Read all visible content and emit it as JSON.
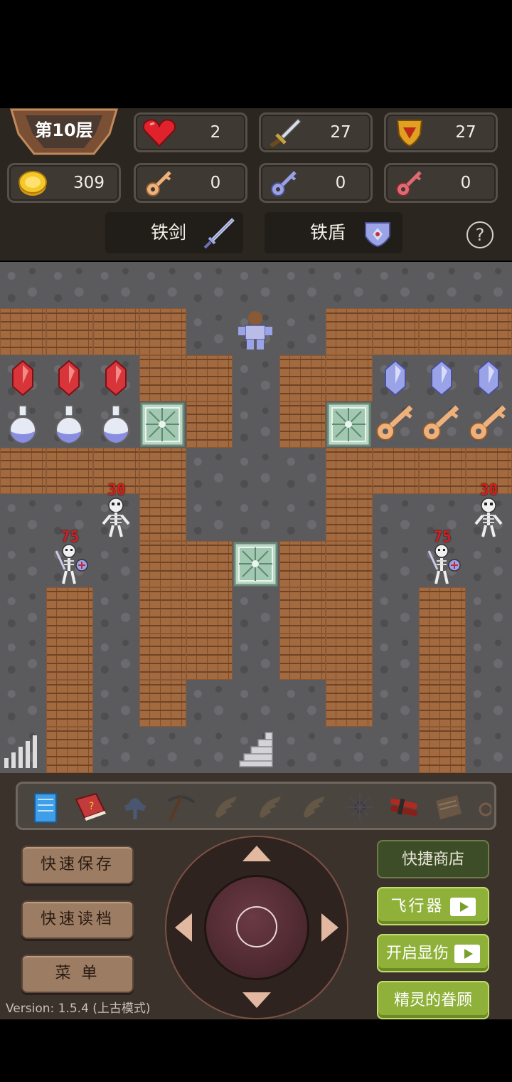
{
  "floor_label": "第10层",
  "stats": {
    "hp": "2",
    "attack": "27",
    "defense": "27",
    "gold": "309",
    "yellow_keys": "0",
    "blue_keys": "0",
    "red_keys": "0"
  },
  "equipment": {
    "weapon": "铁剑",
    "shield": "铁盾"
  },
  "help": "?",
  "monsters": {
    "skeleton_hp": "30",
    "skeleton_captain_hp": "75"
  },
  "buttons": {
    "quick_save": "快速保存",
    "quick_load": "快速读档",
    "menu": "菜 单",
    "quick_shop": "快捷商店",
    "flyer": "飞行器",
    "show_damage": "开启显伤",
    "fairy_favor": "精灵的眷顾"
  },
  "version": "Version: 1.5.4 (上古模式)",
  "colors": {
    "hud_bg": "#2c2621",
    "wall": "#a46a3f",
    "floor": "#5b5b5e",
    "button_green": "#8fb139",
    "button_brown": "#9c7d63",
    "monster_hp": "#d61e1e"
  }
}
